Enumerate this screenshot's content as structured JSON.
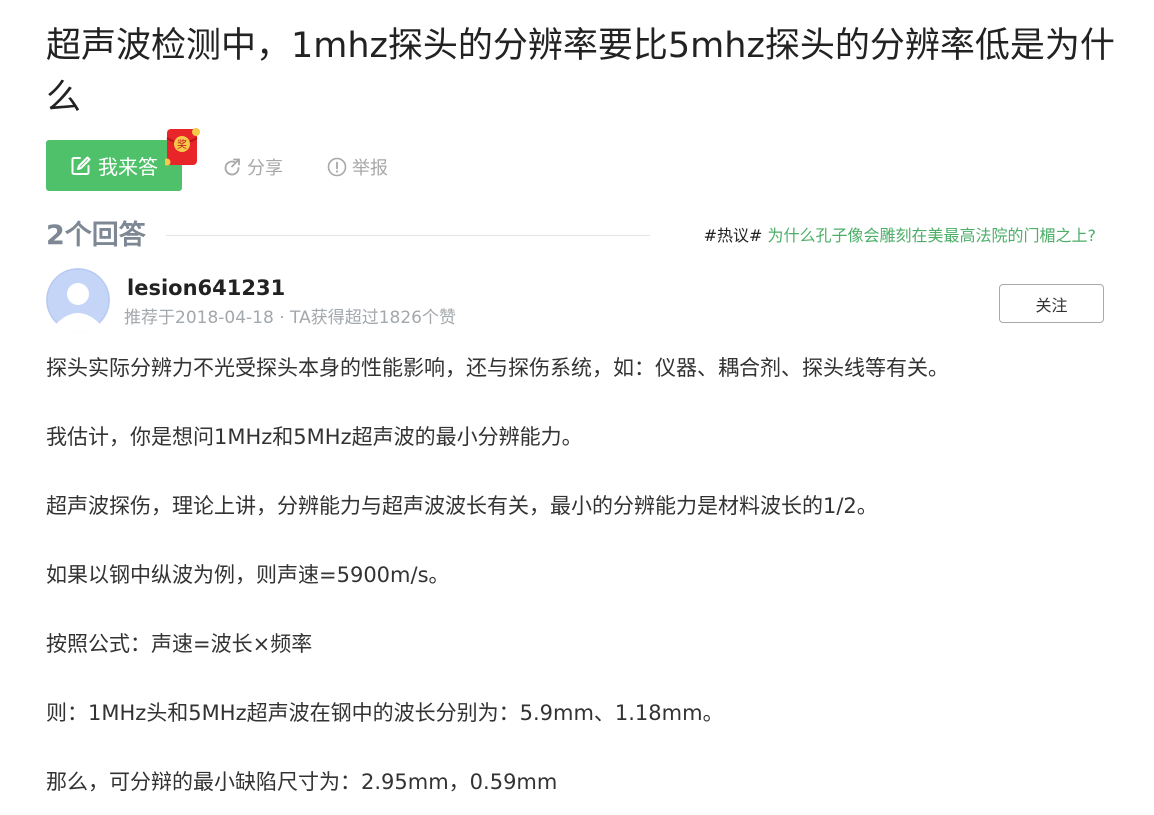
{
  "question": {
    "title": "超声波检测中，1mhz探头的分辨率要比5mhz探头的分辨率低是为什么"
  },
  "actions": {
    "answer_label": "我来答",
    "share_label": "分享",
    "report_label": "举报",
    "redpacket_label": "奖"
  },
  "answers_header": {
    "count_label": "2个回答",
    "hot_tag": "#热议#",
    "hot_topic": "为什么孔子像会雕刻在美最高法院的门楣之上?"
  },
  "answer": {
    "username": "lesion641231",
    "meta": "推荐于2018-04-18 · TA获得超过1826个赞",
    "follow_label": "关注",
    "paragraphs": [
      "探头实际分辨力不光受探头本身的性能影响，还与探伤系统，如：仪器、耦合剂、探头线等有关。",
      "我估计，你是想问1MHz和5MHz超声波的最小分辨能力。",
      "超声波探伤，理论上讲，分辨能力与超声波波长有关，最小的分辨能力是材料波长的1/2。",
      "如果以钢中纵波为例，则声速=5900m/s。",
      "按照公式：声速=波长×频率",
      "则：1MHz头和5MHz超声波在钢中的波长分别为：5.9mm、1.18mm。",
      "那么，可分辩的最小缺陷尺寸为：2.95mm，0.59mm"
    ]
  },
  "colors": {
    "accent_green": "#4fc16a",
    "link_green": "#4cae68",
    "muted_gray": "#a8a8a8"
  }
}
